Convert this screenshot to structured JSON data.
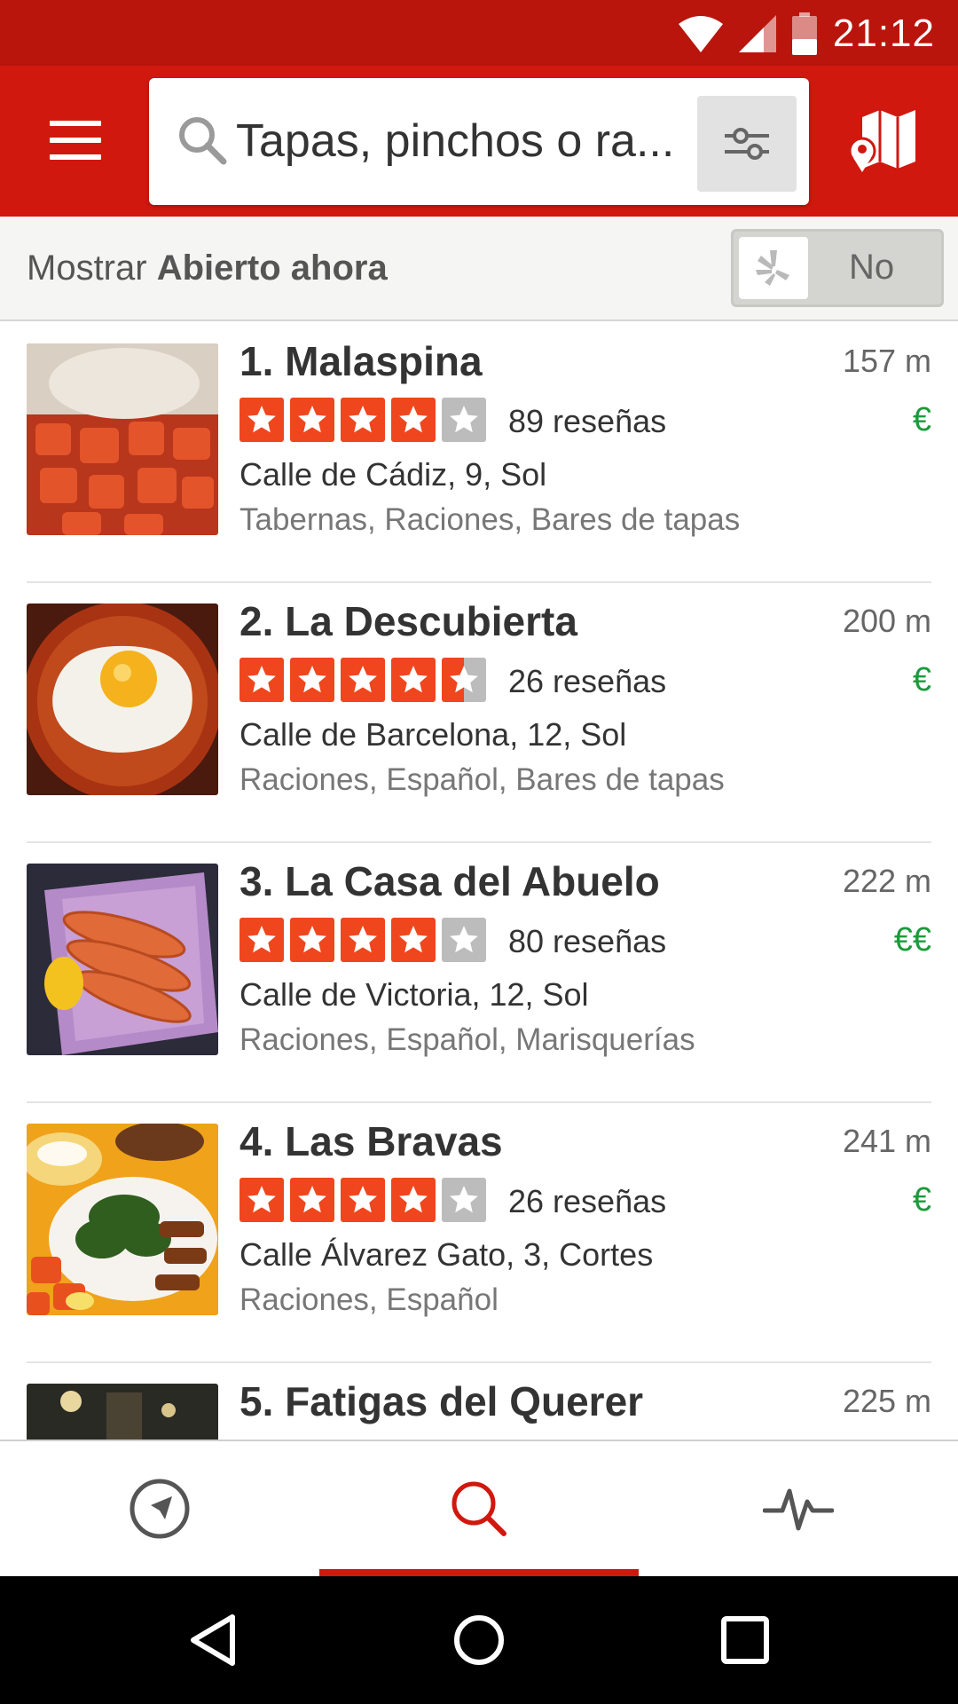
{
  "status_bar": {
    "time": "21:12",
    "icons": [
      "wifi-icon",
      "signal-icon",
      "battery-icon"
    ]
  },
  "app_bar": {
    "menu_icon": "hamburger-menu-icon",
    "search": {
      "text": "Tapas, pinchos o ra...",
      "icon": "search-icon",
      "filter_icon": "filter-sliders-icon"
    },
    "map_icon": "map-icon"
  },
  "open_now": {
    "prefix": "Mostrar ",
    "bold": "Abierto ahora",
    "toggle_label": "No",
    "toggle_icon": "yelp-burst-icon"
  },
  "results": [
    {
      "name": "1. Malaspina",
      "distance": "157 m",
      "rating": 4,
      "reviews": "89 reseñas",
      "price": "€",
      "address": "Calle de Cádiz, 9, Sol",
      "categories": "Tabernas, Raciones, Bares de tapas"
    },
    {
      "name": "2. La Descubierta",
      "distance": "200 m",
      "rating": 4.5,
      "reviews": "26 reseñas",
      "price": "€",
      "address": "Calle de Barcelona, 12, Sol",
      "categories": "Raciones, Español, Bares de tapas"
    },
    {
      "name": "3. La Casa del Abuelo",
      "distance": "222 m",
      "rating": 4,
      "reviews": "80 reseñas",
      "price": "€€",
      "address": "Calle de Victoria, 12, Sol",
      "categories": "Raciones, Español, Marisquerías"
    },
    {
      "name": "4. Las Bravas",
      "distance": "241 m",
      "rating": 4,
      "reviews": "26 reseñas",
      "price": "€",
      "address": "Calle Álvarez Gato, 3, Cortes",
      "categories": "Raciones, Español"
    },
    {
      "name": "5. Fatigas del Querer",
      "distance": "225 m",
      "rating": null,
      "reviews": "",
      "price": "",
      "address": "",
      "categories": ""
    }
  ],
  "bottom_nav": {
    "tabs": [
      "nearby-compass-icon",
      "search-icon",
      "activity-pulse-icon"
    ],
    "active": 1
  },
  "colors": {
    "brand_red": "#d0180f",
    "star_red": "#f0461e",
    "price_green": "#1a9b3a"
  }
}
